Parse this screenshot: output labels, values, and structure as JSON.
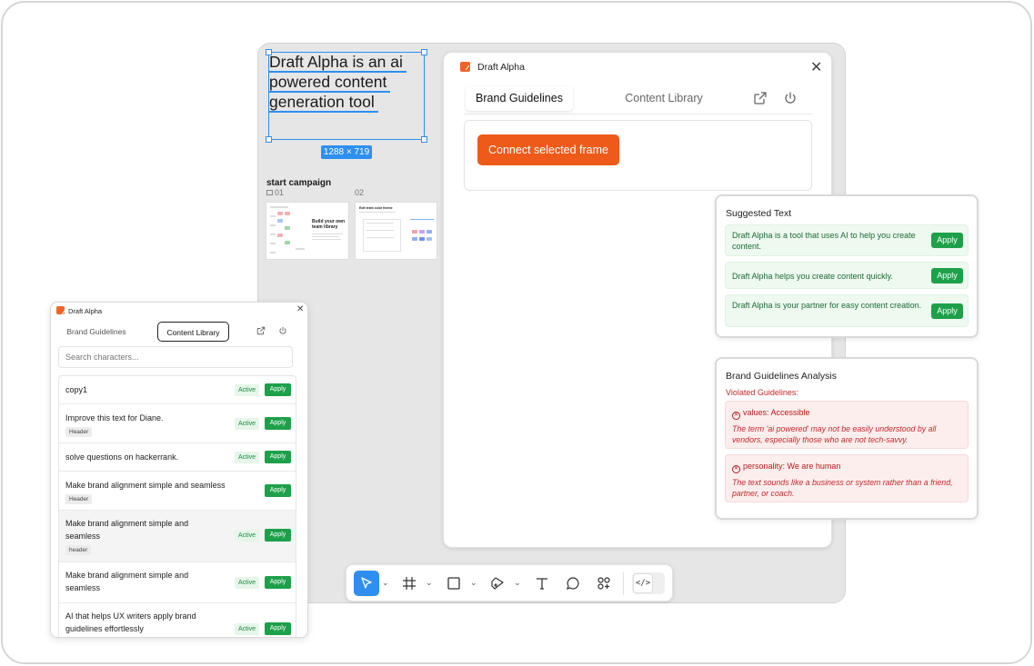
{
  "canvas": {
    "text_frame_lines": [
      "Draft Alpha is an ai",
      "powered content",
      "generation tool"
    ],
    "frame_size_label": "1288 × 719",
    "campaign_title": "start campaign",
    "thumbnails": [
      {
        "number": "01",
        "heading": "Build your own team library"
      },
      {
        "number": "02",
        "heading": "Edit team color theme"
      }
    ]
  },
  "main_panel": {
    "title": "Draft Alpha",
    "tabs": [
      {
        "label": "Brand Guidelines",
        "active": true
      },
      {
        "label": "Content Library",
        "active": false
      }
    ],
    "connect_button": "Connect selected frame"
  },
  "suggested_text": {
    "title": "Suggested Text",
    "items": [
      {
        "text": "Draft Alpha is a tool that uses AI to help you create content.",
        "button": "Apply"
      },
      {
        "text": "Draft Alpha helps you create content quickly.",
        "button": "Apply"
      },
      {
        "text": "Draft Alpha is your partner for easy content creation.",
        "button": "Apply"
      }
    ]
  },
  "analysis": {
    "title": "Brand Guidelines Analysis",
    "violated_label": "Violated Guidelines:",
    "items": [
      {
        "heading": "values: Accessible",
        "description": "The term 'ai powered' may not be easily understood by all vendors, especially those who are not tech-savvy."
      },
      {
        "heading": "personality: We are human",
        "description": "The text sounds like a business or system rather than a friend, partner, or coach."
      }
    ]
  },
  "toolbar": {
    "tools": [
      "move-tool",
      "frame-tool",
      "shape-tool",
      "pen-tool",
      "text-tool",
      "comment-tool",
      "components-tool"
    ],
    "selected": "move-tool",
    "code_toggle": "</>"
  },
  "small_panel": {
    "title": "Draft Alpha",
    "tabs": [
      {
        "label": "Brand Guidelines",
        "active": false
      },
      {
        "label": "Content Library",
        "active": true
      }
    ],
    "search_placeholder": "Search characters...",
    "rows": [
      {
        "text": "copy1",
        "tag": "",
        "active": "Active",
        "button": "Apply"
      },
      {
        "text": "Improve this text for Diane.",
        "tag": "Header",
        "active": "Active",
        "button": "Apply"
      },
      {
        "text": "solve questions on hackerrank.",
        "tag": "",
        "active": "Active",
        "button": "Apply"
      },
      {
        "text": "Make brand alignment simple and seamless",
        "tag": "Header",
        "active": "",
        "button": "Apply"
      },
      {
        "text": "Make brand alignment simple and seamless",
        "tag": "header",
        "active": "Active",
        "button": "Apply"
      },
      {
        "text": "Make brand alignment simple and seamless",
        "tag": "",
        "active": "Active",
        "button": "Apply"
      },
      {
        "text": "AI that helps UX writers apply brand guidelines effortlessly",
        "tag": "",
        "active": "Active",
        "button": "Apply"
      }
    ]
  },
  "colors": {
    "accent": "#ee5a1a",
    "selection": "#2f8ff0",
    "apply_green": "#1ea04a",
    "violation_red": "#c62828"
  }
}
